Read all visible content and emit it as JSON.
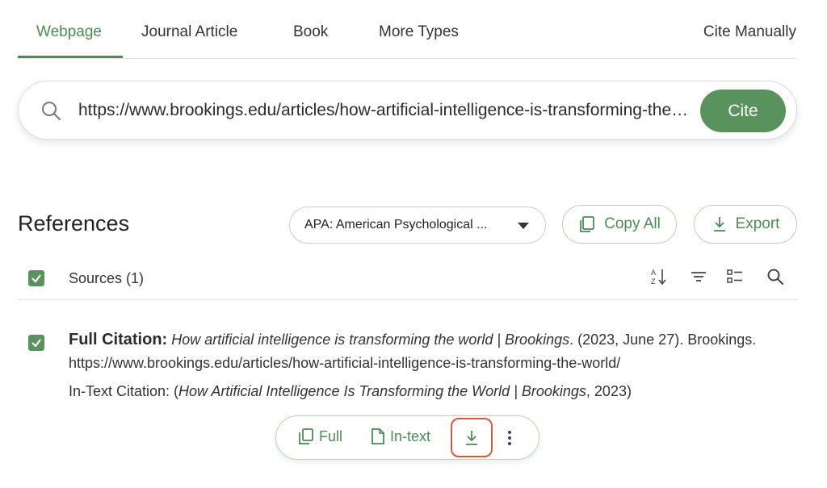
{
  "tabs": [
    {
      "label": "Webpage"
    },
    {
      "label": "Journal Article"
    },
    {
      "label": "Book"
    },
    {
      "label": "More Types"
    }
  ],
  "cite_manually": "Cite Manually",
  "search": {
    "value": "https://www.brookings.edu/articles/how-artificial-intelligence-is-transforming-the-world/"
  },
  "cite_button": "Cite",
  "references": {
    "title": "References",
    "style_select": "APA: American Psychological ...",
    "copy_all": "Copy All",
    "export": "Export",
    "sources_label": "Sources (1)"
  },
  "citation": {
    "full_label": "Full Citation:",
    "full_title": "How artificial intelligence is transforming the world | Brookings",
    "full_rest": ". (2023, June 27). Brookings. https://www.brookings.edu/articles/how-artificial-intelligence-is-transforming-the-world/",
    "intext_prefix": "In-Text Citation: (",
    "intext_title": "How Artificial Intelligence Is Transforming the World | Brookings",
    "intext_suffix": ", 2023)"
  },
  "actions": {
    "full": "Full",
    "intext": "In-text"
  },
  "colors": {
    "accent": "#5a925e",
    "accent_text": "#4e8a55",
    "highlight": "#d65a3a"
  }
}
